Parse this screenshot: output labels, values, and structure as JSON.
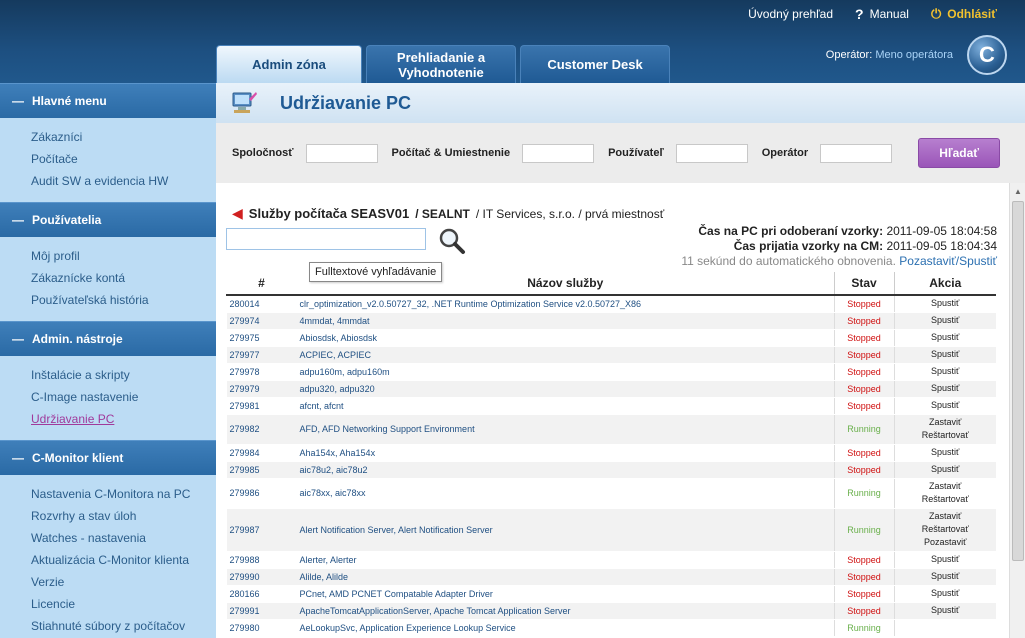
{
  "top_links": {
    "overview": "Úvodný prehľad",
    "manual": "Manual",
    "logout": "Odhlásiť"
  },
  "tabs": [
    {
      "label": "Admin zóna"
    },
    {
      "label": "Prehliadanie a Vyhodnotenie"
    },
    {
      "label": "Customer Desk"
    }
  ],
  "operator": {
    "label": "Operátor:",
    "name": "Meno operátora"
  },
  "logo_letter": "C",
  "sidebar": {
    "sections": [
      {
        "title": "Hlavné menu",
        "items": [
          "Zákazníci",
          "Počítače",
          "Audit SW a evidencia HW"
        ]
      },
      {
        "title": "Používatelia",
        "items": [
          "Môj profil",
          "Zákaznícke kontá",
          "Používateľská história"
        ]
      },
      {
        "title": "Admin. nástroje",
        "items": [
          "Inštalácie a skripty",
          "C-Image nastavenie",
          "Udržiavanie PC"
        ]
      },
      {
        "title": "C-Monitor klient",
        "items": [
          "Nastavenia C-Monitora na PC",
          "Rozvrhy a stav úloh",
          "Watches - nastavenia",
          "Aktualizácia C-Monitor klienta",
          "Verzie",
          "Licencie",
          "Stiahnuté súbory z počítačov"
        ]
      }
    ]
  },
  "main": {
    "title": "Udržiavanie PC",
    "filters": {
      "company": "Spoločnosť",
      "computer": "Počítač & Umiestnenie",
      "user": "Používateľ",
      "operator": "Operátor",
      "search_button": "Hľadať"
    },
    "services": {
      "title_bold": "Služby počítača SEASV01",
      "title_sub": "/ SEALNT",
      "title_rest": "/ IT Services, s.r.o. / prvá miestnosť",
      "tooltip": "Fulltextové vyhľadávanie",
      "sample_time_label": "Čas na PC pri odoberaní vzorky:",
      "sample_time": "2011-09-05 18:04:58",
      "receive_time_label": "Čas prijatia vzorky na CM:",
      "receive_time": "2011-09-05 18:04:34",
      "refresh_text": "11 sekúnd do automatického obnovenia.",
      "refresh_link": "Pozastaviť/Spustiť",
      "columns": [
        "#",
        "Názov služby",
        "Stav",
        "Akcia"
      ],
      "rows": [
        {
          "id": "280014",
          "name": "clr_optimization_v2.0.50727_32, .NET Runtime Optimization Service v2.0.50727_X86",
          "status": "Stopped",
          "actions": [
            "Spustiť"
          ]
        },
        {
          "id": "279974",
          "name": "4mmdat, 4mmdat",
          "status": "Stopped",
          "actions": [
            "Spustiť"
          ]
        },
        {
          "id": "279975",
          "name": "Abiosdsk, Abiosdsk",
          "status": "Stopped",
          "actions": [
            "Spustiť"
          ]
        },
        {
          "id": "279977",
          "name": "ACPIEC, ACPIEC",
          "status": "Stopped",
          "actions": [
            "Spustiť"
          ]
        },
        {
          "id": "279978",
          "name": "adpu160m, adpu160m",
          "status": "Stopped",
          "actions": [
            "Spustiť"
          ]
        },
        {
          "id": "279979",
          "name": "adpu320, adpu320",
          "status": "Stopped",
          "actions": [
            "Spustiť"
          ]
        },
        {
          "id": "279981",
          "name": "afcnt, afcnt",
          "status": "Stopped",
          "actions": [
            "Spustiť"
          ]
        },
        {
          "id": "279982",
          "name": "AFD, AFD Networking Support Environment",
          "status": "Running",
          "actions": [
            "Zastaviť",
            "Reštartovať"
          ]
        },
        {
          "id": "279984",
          "name": "Aha154x, Aha154x",
          "status": "Stopped",
          "actions": [
            "Spustiť"
          ]
        },
        {
          "id": "279985",
          "name": "aic78u2, aic78u2",
          "status": "Stopped",
          "actions": [
            "Spustiť"
          ]
        },
        {
          "id": "279986",
          "name": "aic78xx, aic78xx",
          "status": "Running",
          "actions": [
            "Zastaviť",
            "Reštartovať"
          ]
        },
        {
          "id": "279987",
          "name": "Alert Notification Server, Alert Notification Server",
          "status": "Running",
          "actions": [
            "Zastaviť",
            "Reštartovať",
            "Pozastaviť"
          ]
        },
        {
          "id": "279988",
          "name": "Alerter, Alerter",
          "status": "Stopped",
          "actions": [
            "Spustiť"
          ]
        },
        {
          "id": "279990",
          "name": "Alilde, Alilde",
          "status": "Stopped",
          "actions": [
            "Spustiť"
          ]
        },
        {
          "id": "280166",
          "name": "PCnet, AMD PCNET Compatable Adapter Driver",
          "status": "Stopped",
          "actions": [
            "Spustiť"
          ]
        },
        {
          "id": "279991",
          "name": "ApacheTomcatApplicationServer, Apache Tomcat Application Server",
          "status": "Stopped",
          "actions": [
            "Spustiť"
          ]
        },
        {
          "id": "279980",
          "name": "AeLookupSvc, Application Experience Lookup Service",
          "status": "Running",
          "actions": [
            ""
          ]
        }
      ]
    }
  },
  "colors": {
    "stopped": "#d01010",
    "running": "#6ab04c",
    "accent": "#1f5a94",
    "search_button": "#9a55b8"
  }
}
